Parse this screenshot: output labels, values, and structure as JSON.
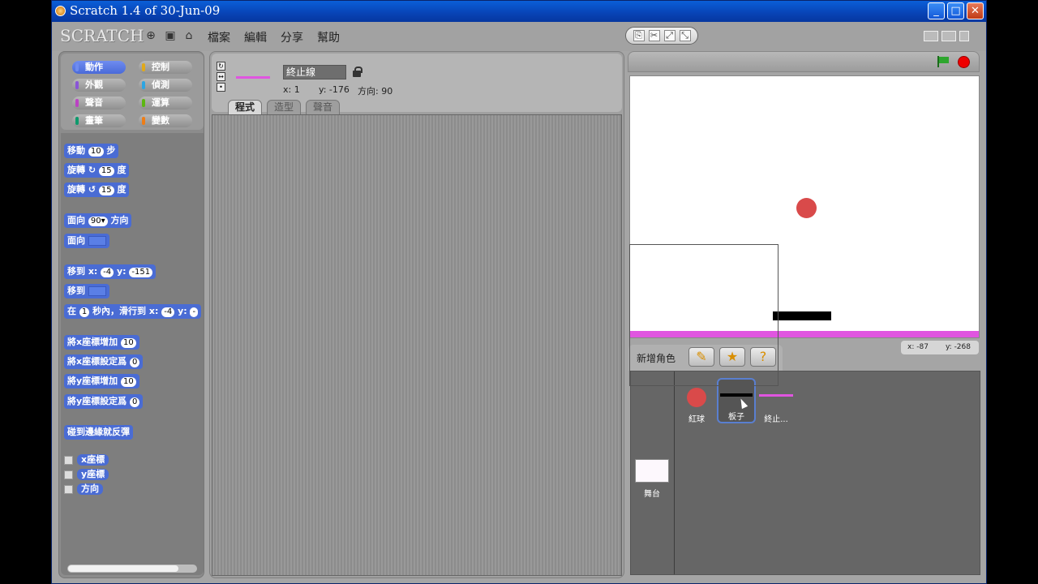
{
  "window": {
    "title": "Scratch 1.4 of 30-Jun-09"
  },
  "menubar": {
    "logo": "SCRATCH",
    "menus": [
      "檔案",
      "編輯",
      "分享",
      "幫助"
    ]
  },
  "categories": [
    {
      "label": "動作",
      "color": "#4a6cd4"
    },
    {
      "label": "控制",
      "color": "#e1a91a"
    },
    {
      "label": "外觀",
      "color": "#8a55d7"
    },
    {
      "label": "偵測",
      "color": "#2ca5e2"
    },
    {
      "label": "聲音",
      "color": "#bb42c3"
    },
    {
      "label": "運算",
      "color": "#5cb712"
    },
    {
      "label": "畫筆",
      "color": "#0e9a6c"
    },
    {
      "label": "變數",
      "color": "#ee7d16"
    }
  ],
  "blocks": {
    "move": {
      "pre": "移動",
      "val": "10",
      "post": "步"
    },
    "turn_cw": {
      "pre": "旋轉 ↻",
      "val": "15",
      "post": "度"
    },
    "turn_ccw": {
      "pre": "旋轉 ↺",
      "val": "15",
      "post": "度"
    },
    "point_dir": {
      "pre": "面向",
      "val": "90▾",
      "post": "方向"
    },
    "point_towards": {
      "pre": "面向"
    },
    "goto_xy": {
      "pre": "移到 x:",
      "x": "-4",
      "mid": "y:",
      "y": "-151"
    },
    "goto": {
      "pre": "移到"
    },
    "glide": {
      "pre": "在",
      "secs": "1",
      "mid": "秒內，滑行到 x:",
      "x": "-4",
      "tail": "y:"
    },
    "change_x": {
      "pre": "將x座標增加",
      "val": "10"
    },
    "set_x": {
      "pre": "將x座標設定爲",
      "val": "0"
    },
    "change_y": {
      "pre": "將y座標增加",
      "val": "10"
    },
    "set_y": {
      "pre": "將y座標設定爲",
      "val": "0"
    },
    "bounce": {
      "pre": "碰到邊緣就反彈"
    },
    "reporters": [
      "x座標",
      "y座標",
      "方向"
    ]
  },
  "sprite": {
    "name": "終止線",
    "x_label": "x: 1",
    "y_label": "y: -176",
    "dir_label": "方向: 90"
  },
  "tabs": [
    "程式",
    "造型",
    "聲音"
  ],
  "stage": {
    "mouse_x": "x: -87",
    "mouse_y": "y: -268"
  },
  "newsprite": {
    "label": "新增角色"
  },
  "sprites": [
    {
      "name": "紅球"
    },
    {
      "name": "板子"
    },
    {
      "name": "終止..."
    }
  ],
  "stage_thumb": {
    "label": "舞台"
  }
}
